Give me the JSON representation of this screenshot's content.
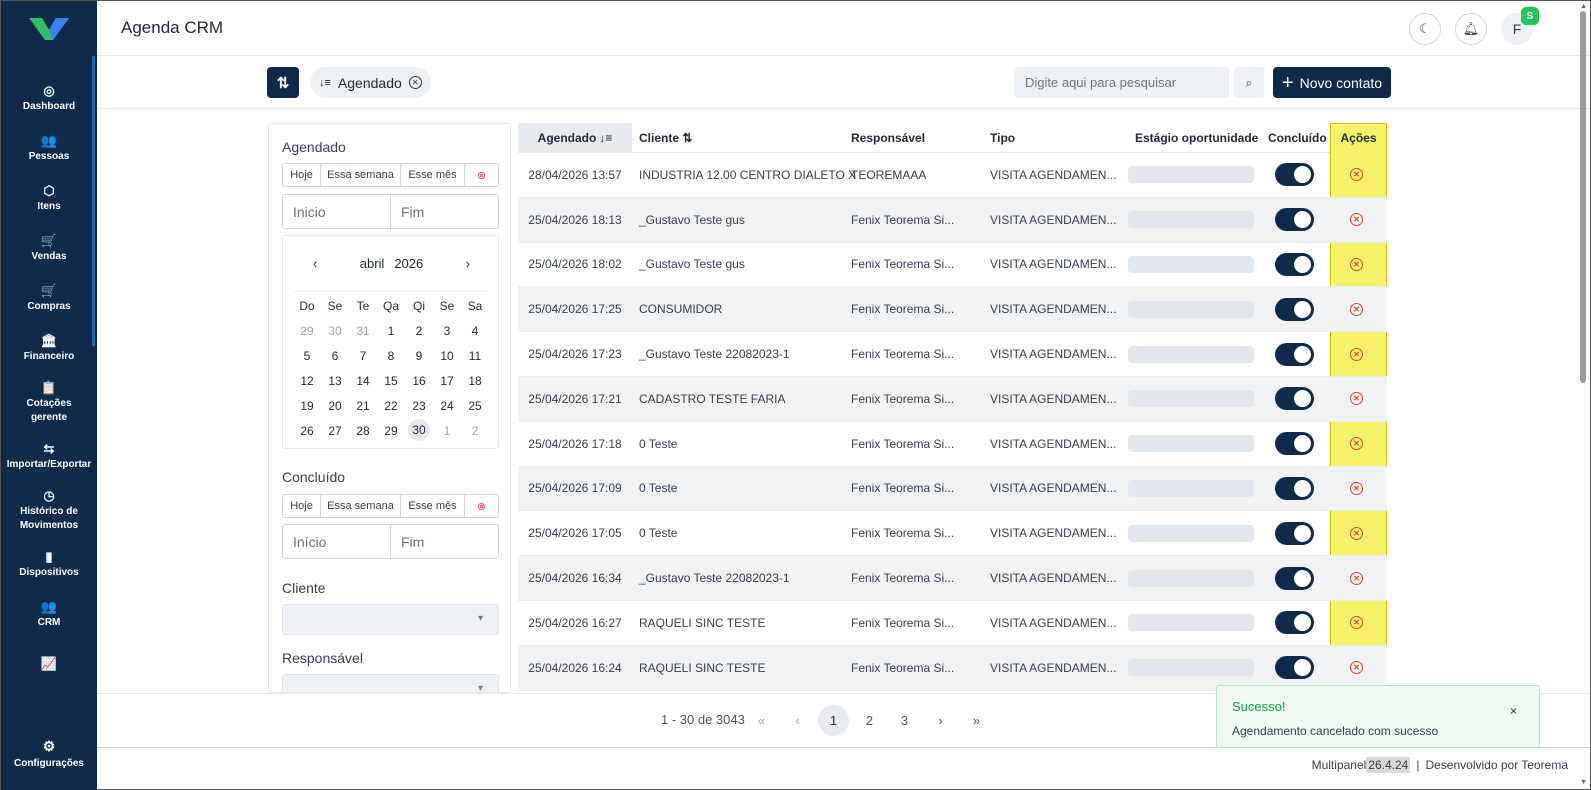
{
  "header": {
    "title": "Agenda CRM",
    "avatar_initial": "F",
    "badge": "S"
  },
  "sidebar": {
    "items": [
      {
        "icon": "dashboard-icon",
        "glyph": "◎",
        "label": "Dashboard"
      },
      {
        "icon": "people-icon",
        "glyph": "👥",
        "label": "Pessoas"
      },
      {
        "icon": "box-icon",
        "glyph": "⬡",
        "label": "Itens"
      },
      {
        "icon": "cart-icon",
        "glyph": "🛒",
        "label": "Vendas"
      },
      {
        "icon": "cart-icon",
        "glyph": "🛒",
        "label": "Compras"
      },
      {
        "icon": "bank-icon",
        "glyph": "🏛",
        "label": "Financeiro"
      },
      {
        "icon": "clipboard-icon",
        "glyph": "📋",
        "label1": "Cotações",
        "label2": "gerente"
      },
      {
        "icon": "swap-icon",
        "glyph": "⇆",
        "label": "Importar/Exportar"
      },
      {
        "icon": "history-icon",
        "glyph": "◷",
        "label1": "Histórico de",
        "label2": "Movimentos"
      },
      {
        "icon": "device-icon",
        "glyph": "▮",
        "label": "Dispositivos"
      },
      {
        "icon": "crm-icon",
        "glyph": "👥",
        "label": "CRM"
      },
      {
        "icon": "chart-icon",
        "glyph": "📈",
        "label": ""
      }
    ],
    "footer_label": "Configurações"
  },
  "toolbar": {
    "chip_label": "Agendado",
    "search_placeholder": "Digite aqui para pesquisar",
    "new_label": "Novo contato"
  },
  "filters": {
    "agendado_label": "Agendado",
    "concluido_label": "Concluído",
    "quick": [
      "Hoje",
      "Essa semana",
      "Esse mês"
    ],
    "start_placeholder": "Inicio",
    "start_placeholder2": "Início",
    "end_placeholder": "Fim",
    "cliente_label": "Cliente",
    "responsavel_label": "Responsável",
    "calendar": {
      "month": "abril",
      "year": "2026",
      "dow": [
        "Do",
        "Se",
        "Te",
        "Qa",
        "Qi",
        "Se",
        "Sa"
      ],
      "days": [
        "29",
        "30",
        "31",
        "1",
        "2",
        "3",
        "4",
        "5",
        "6",
        "7",
        "8",
        "9",
        "10",
        "11",
        "12",
        "13",
        "14",
        "15",
        "16",
        "17",
        "18",
        "19",
        "20",
        "21",
        "22",
        "23",
        "24",
        "25",
        "26",
        "27",
        "28",
        "29",
        "30",
        "1",
        "2"
      ],
      "selected": "30"
    }
  },
  "table": {
    "headers": {
      "agendado": "Agendado",
      "cliente": "Cliente",
      "responsavel": "Responsável",
      "tipo": "Tipo",
      "estagio": "Estágio oportunidade",
      "concluido": "Concluído",
      "acoes": "Ações"
    },
    "rows": [
      {
        "date": "28/04/2026 13:57",
        "client": "INDUSTRIA 12.00 CENTRO DIALETO X",
        "resp": "TEOREMAAA",
        "tipo": "VISITA AGENDAMEN..."
      },
      {
        "date": "25/04/2026 18:13",
        "client": "_Gustavo Teste gus",
        "resp": "Fenix Teorema Si...",
        "tipo": "VISITA AGENDAMEN..."
      },
      {
        "date": "25/04/2026 18:02",
        "client": "_Gustavo Teste gus",
        "resp": "Fenix Teorema Si...",
        "tipo": "VISITA AGENDAMEN..."
      },
      {
        "date": "25/04/2026 17:25",
        "client": "CONSUMIDOR",
        "resp": "Fenix Teorema Si...",
        "tipo": "VISITA AGENDAMEN..."
      },
      {
        "date": "25/04/2026 17:23",
        "client": "_Gustavo Teste 22082023-1",
        "resp": "Fenix Teorema Si...",
        "tipo": "VISITA AGENDAMEN..."
      },
      {
        "date": "25/04/2026 17:21",
        "client": "CADASTRO TESTE FARIA",
        "resp": "Fenix Teorema Si...",
        "tipo": "VISITA AGENDAMEN..."
      },
      {
        "date": "25/04/2026 17:18",
        "client": "0 Teste",
        "resp": "Fenix Teorema Si...",
        "tipo": "VISITA AGENDAMEN..."
      },
      {
        "date": "25/04/2026 17:09",
        "client": "0 Teste",
        "resp": "Fenix Teorema Si...",
        "tipo": "VISITA AGENDAMEN..."
      },
      {
        "date": "25/04/2026 17:05",
        "client": "0 Teste",
        "resp": "Fenix Teorema Si...",
        "tipo": "VISITA AGENDAMEN..."
      },
      {
        "date": "25/04/2026 16:34",
        "client": "_Gustavo Teste 22082023-1",
        "resp": "Fenix Teorema Si...",
        "tipo": "VISITA AGENDAMEN..."
      },
      {
        "date": "25/04/2026 16:27",
        "client": "RAQUELI SINC TESTE",
        "resp": "Fenix Teorema Si...",
        "tipo": "VISITA AGENDAMEN..."
      },
      {
        "date": "25/04/2026 16:24",
        "client": "RAQUELI SINC TESTE",
        "resp": "Fenix Teorema Si...",
        "tipo": "VISITA AGENDAMEN..."
      }
    ]
  },
  "pagination": {
    "info": "1 - 30 de 3043",
    "first": "«",
    "prev": "‹",
    "pages": [
      "1",
      "2",
      "3"
    ],
    "next": "›",
    "last": "»"
  },
  "footer": {
    "app": "Multipanel",
    "version": "26.4.24",
    "sep": "|",
    "dev": "Desenvolvido por Teorema"
  },
  "toast": {
    "title": "Sucesso!",
    "message": "Agendamento cancelado com sucesso",
    "close": "×"
  }
}
